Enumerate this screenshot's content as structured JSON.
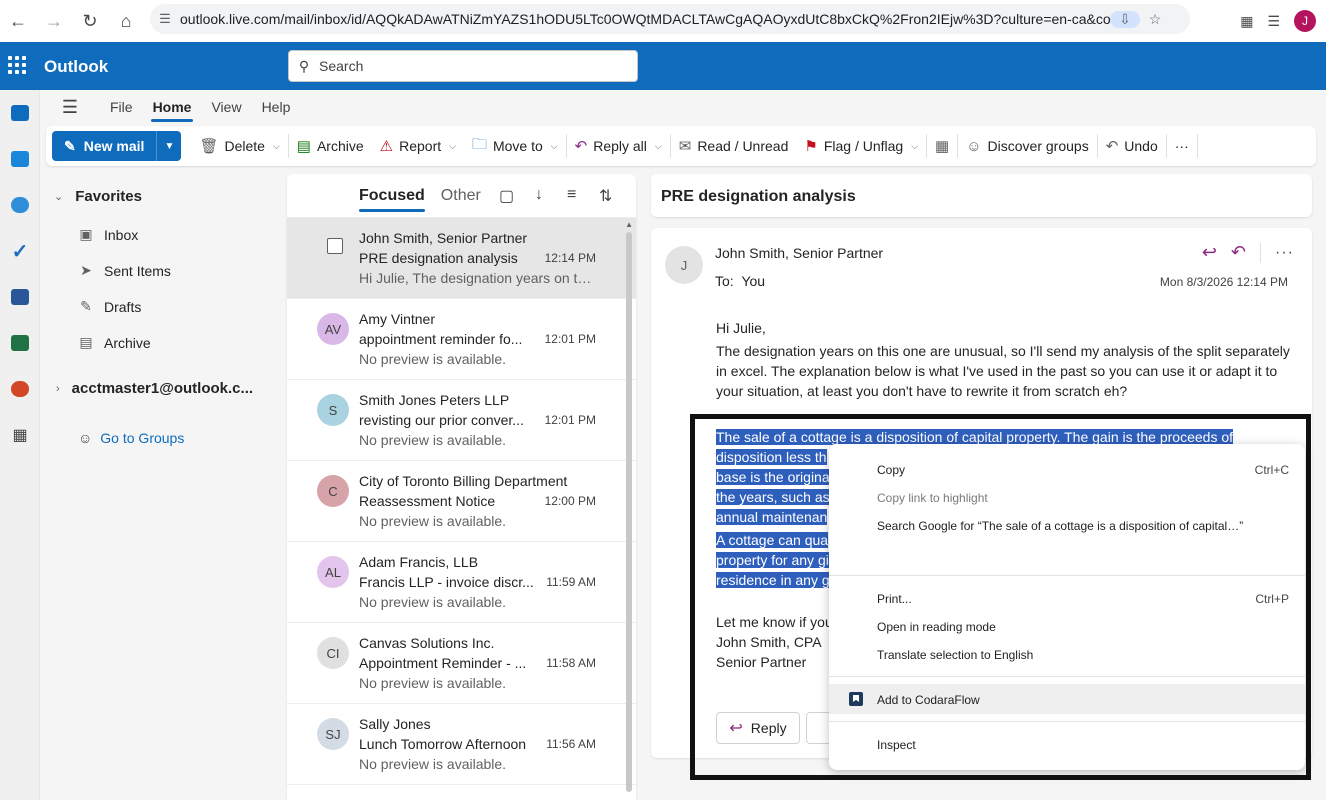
{
  "browser": {
    "url": "outlook.live.com/mail/inbox/id/AQQkADAwATNiZmYAZS1hODU5LTc0OWQtMDACLTAwCgAQAOyxdUtC8bxCkQ%2Fron2IEjw%3D?culture=en-ca&co...",
    "profile_initial": "J"
  },
  "app": {
    "name": "Outlook",
    "search_placeholder": "Search"
  },
  "menu_tabs": [
    "File",
    "Home",
    "View",
    "Help"
  ],
  "ribbon": {
    "new_mail": "New mail",
    "delete": "Delete",
    "archive": "Archive",
    "report": "Report",
    "move_to": "Move to",
    "reply_all": "Reply all",
    "read_unread": "Read / Unread",
    "flag_unflag": "Flag / Unflag",
    "discover_groups": "Discover groups",
    "undo": "Undo",
    "more": "···"
  },
  "folders": {
    "favorites": "Favorites",
    "items": [
      "Inbox",
      "Sent Items",
      "Drafts",
      "Archive"
    ],
    "account": "acctmaster1@outlook.c...",
    "go_to_groups": "Go to Groups"
  },
  "list": {
    "focused": "Focused",
    "other": "Other",
    "messages": [
      {
        "initials": "",
        "sender": "John Smith, Senior Partner",
        "subject": "PRE designation analysis",
        "time": "12:14 PM",
        "preview": "Hi Julie, The designation years on thi...",
        "color": "#e6e6e6"
      },
      {
        "initials": "AV",
        "sender": "Amy Vintner",
        "subject": "appointment reminder fo...",
        "time": "12:01 PM",
        "preview": "No preview is available.",
        "color": "#d9b8e8"
      },
      {
        "initials": "S",
        "sender": "Smith Jones Peters LLP",
        "subject": "revisting our prior conver...",
        "time": "12:01 PM",
        "preview": "No preview is available.",
        "color": "#a9d3e0"
      },
      {
        "initials": "C",
        "sender": "City of Toronto Billing Department",
        "subject": "Reassessment Notice",
        "time": "12:00 PM",
        "preview": "No preview is available.",
        "color": "#d6a3a8"
      },
      {
        "initials": "AL",
        "sender": "Adam Francis, LLB",
        "subject": "Francis LLP - invoice discr...",
        "time": "11:59 AM",
        "preview": "No preview is available.",
        "color": "#e3c4ec"
      },
      {
        "initials": "CI",
        "sender": "Canvas Solutions Inc.",
        "subject": "Appointment Reminder - ...",
        "time": "11:58 AM",
        "preview": "No preview is available.",
        "color": "#e0e0e0"
      },
      {
        "initials": "SJ",
        "sender": "Sally Jones",
        "subject": "Lunch Tomorrow Afternoon",
        "time": "11:56 AM",
        "preview": "No preview is available.",
        "color": "#d3dce4"
      }
    ]
  },
  "reading": {
    "subject": "PRE designation analysis",
    "avatar": "J",
    "from": "John Smith, Senior Partner",
    "to_label": "To:",
    "to": "You",
    "date": "Mon 8/3/2026 12:14 PM",
    "greeting": "Hi Julie,",
    "para1": "The designation years on this one are unusual, so I'll send my analysis of the split separately in excel. The explanation below is what I've used in the past so you can use it or adapt it to your situation, at least you don't have to rewrite it from scratch eh?",
    "hl_lines": [
      "The sale of a cottage is a disposition of capital property. The gain is the proceeds of",
      "disposition less th",
      "base is the origina",
      "the years, such as",
      "annual maintenan",
      "A cottage can qua",
      "property for any gi",
      "residence in any g"
    ],
    "closing": "Let me know if you",
    "sig_name": "John Smith, CPA",
    "sig_title": "Senior Partner",
    "reply": "Reply"
  },
  "context_menu": {
    "copy": "Copy",
    "copy_sc": "Ctrl+C",
    "copy_link": "Copy link to highlight",
    "search_google": "Search Google for “The sale of a cottage is a disposition of capital…”",
    "print": "Print...",
    "print_sc": "Ctrl+P",
    "reading_mode": "Open in reading mode",
    "translate": "Translate selection to English",
    "codaraflow": "Add to CodaraFlow",
    "inspect": "Inspect"
  }
}
